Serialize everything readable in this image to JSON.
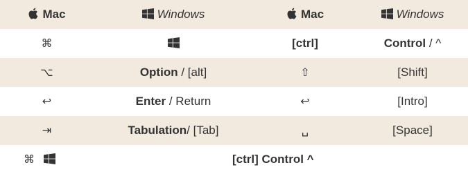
{
  "header": {
    "col1": "Mac",
    "col2": "Windows",
    "col3": "Mac",
    "col4": "Windows"
  },
  "rows": [
    {
      "a_sym": "⌘",
      "c_bold": "[ctrl]",
      "d_bold": "Control",
      "d_rest": " / ^"
    },
    {
      "a_sym": "⌥",
      "b_bold": "Option",
      "b_rest": " / [alt]",
      "c_sym": "⇧",
      "d_text": "[Shift]"
    },
    {
      "a_sym": "↩",
      "b_bold": "Enter",
      "b_rest": " / Return",
      "c_sym": "↩",
      "d_text": "[Intro]"
    },
    {
      "a_sym": "⇥",
      "b_bold": "Tabulation",
      "b_rest": "/ [Tab]",
      "c_sym": "␣",
      "d_text": "[Space]"
    }
  ],
  "footer": {
    "a_sym": "⌘",
    "text": "[ctrl] Control ^"
  },
  "icons": {
    "apple": "apple-logo-icon",
    "windows": "windows-logo-icon"
  },
  "colors": {
    "shade": "#f2e9df",
    "text": "#333333",
    "white": "#ffffff"
  }
}
